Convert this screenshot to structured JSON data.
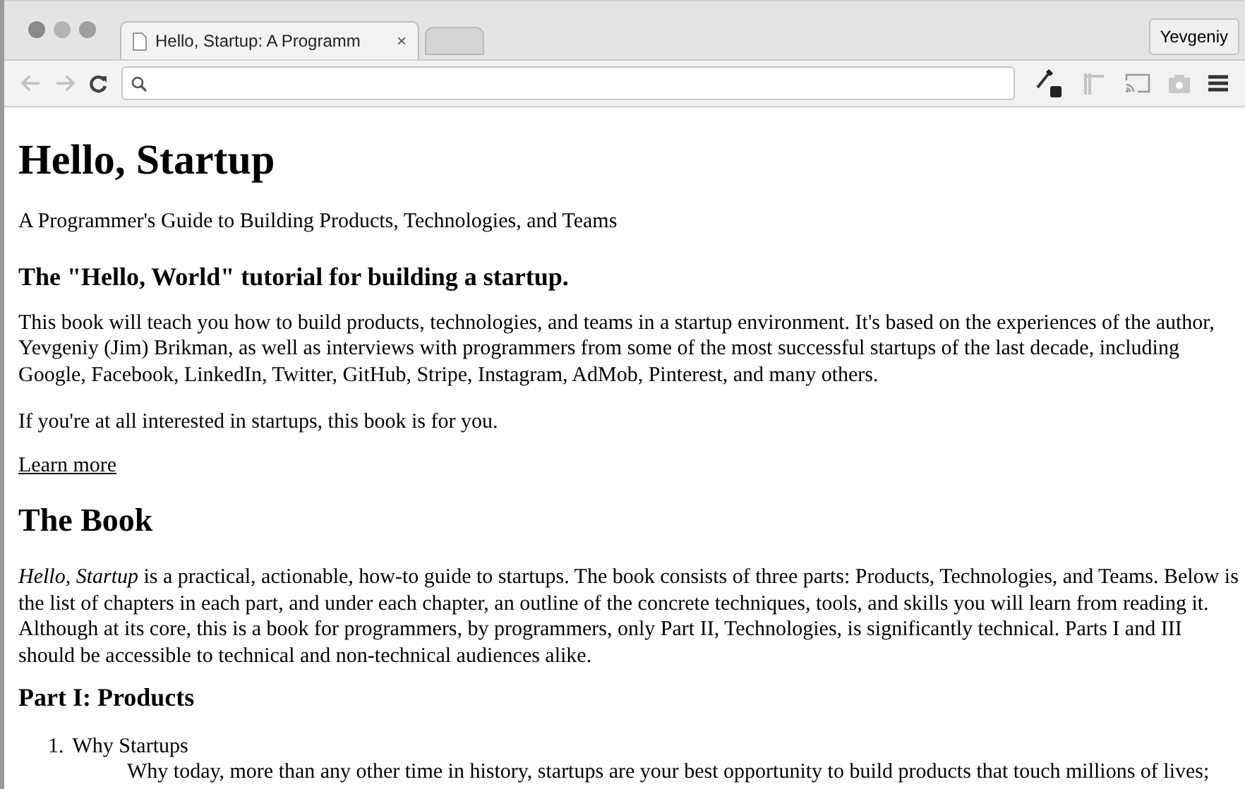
{
  "browser": {
    "tabs": [
      {
        "title": "Hello, Startup: A Programm",
        "close": "×",
        "selected": true
      },
      {
        "selected": false
      }
    ],
    "profile": "Yevgeniy"
  },
  "page": {
    "title": "Hello, Startup",
    "subtitle": "A Programmer's Guide to Building Products, Technologies, and Teams",
    "tagline": "The \"Hello, World\" tutorial for building a startup.",
    "intro": "This book will teach you how to build products, technologies, and teams in a startup environment. It's based on the experiences of the author, Yevgeniy (Jim) Brikman, as well as interviews with programmers from some of the most successful startups of the last decade, including Google, Facebook, LinkedIn, Twitter, GitHub, Stripe, Instagram, AdMob, Pinterest, and many others.",
    "interest": "If you're at all interested in startups, this book is for you.",
    "link": "Learn more",
    "section": "The Book",
    "book_text": "*Hello, Startup* is a practical, actionable, how-to guide to startups. The book consists of three parts: Products, Technologies, and Teams. Below is the list of chapters in each part, and under each chapter, an outline of the concrete techniques, tools, and skills you will learn from reading it. Although at its core, this is a book for programmers, by programmers, only Part II, Technologies, is significantly technical. Parts I and III should be accessible to technical and non-technical audiences alike.",
    "part": "Part I: Products",
    "chapters": [
      {
        "number": "1.",
        "title": "Why Startups",
        "summary": "Why today, more than any other time in history, startups are your best opportunity to build products that touch millions of lives;"
      }
    ]
  }
}
